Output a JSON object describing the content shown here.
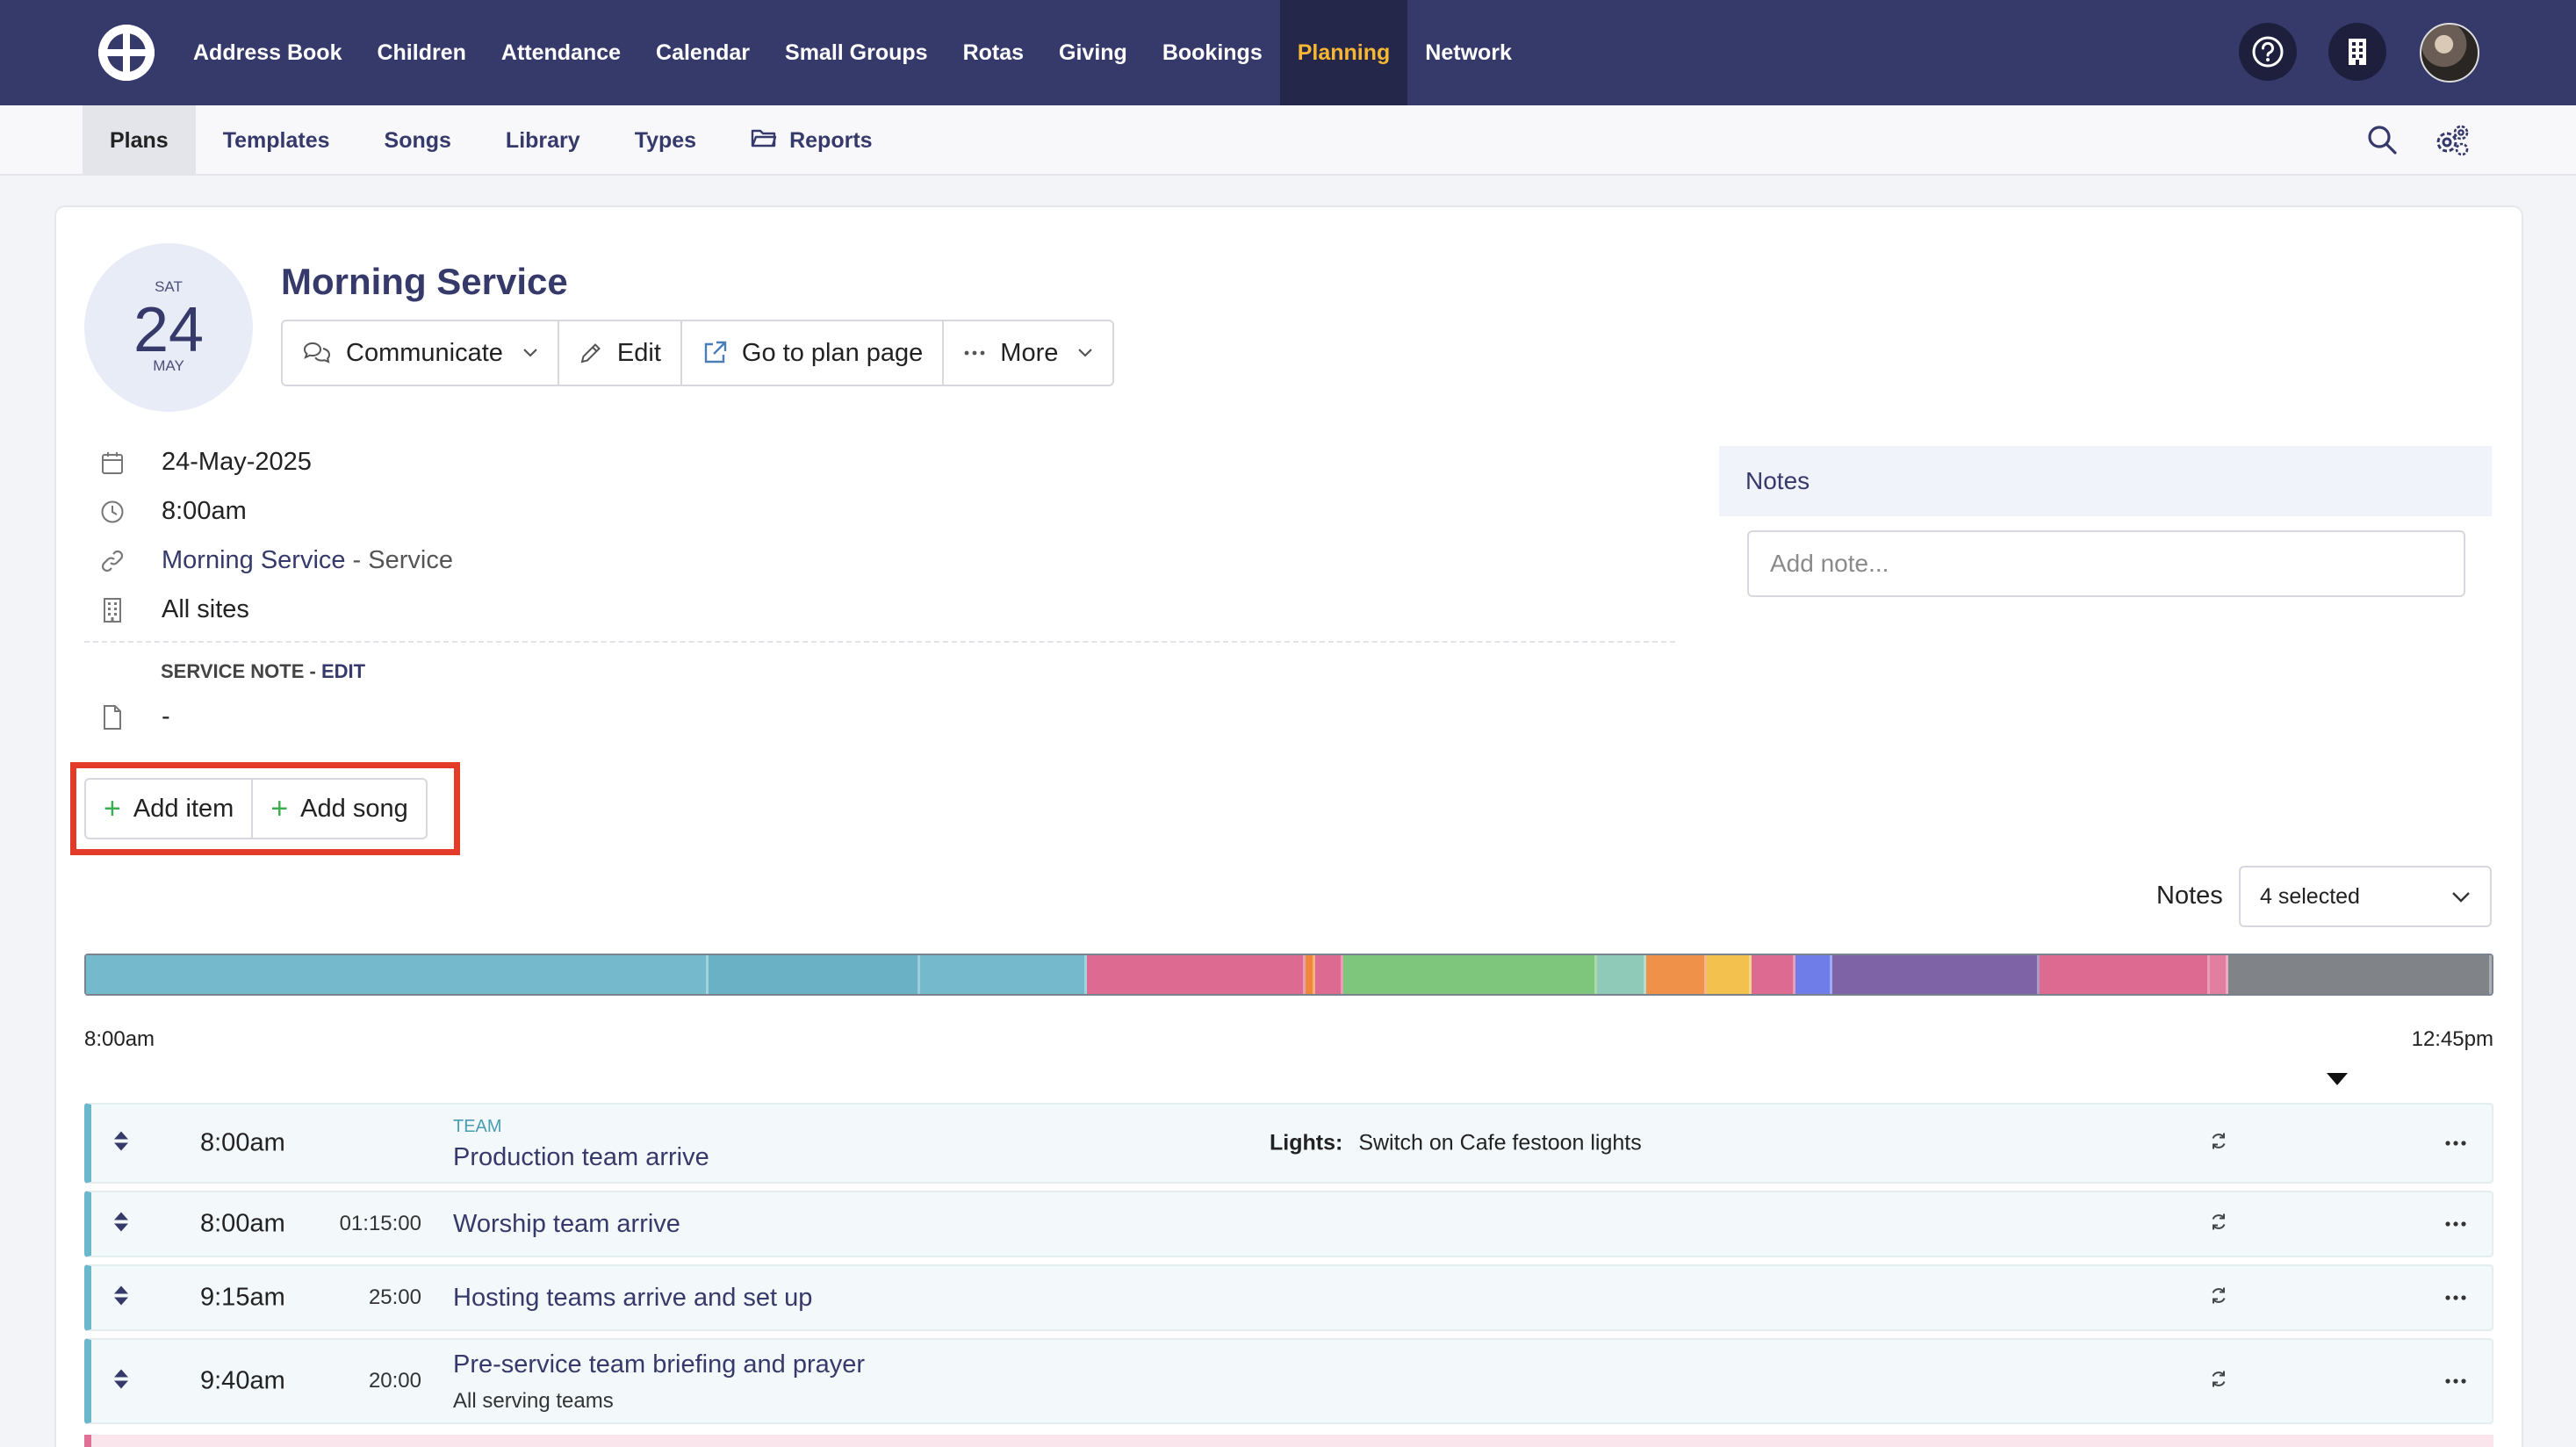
{
  "top_nav": {
    "items": [
      {
        "label": "Address Book"
      },
      {
        "label": "Children"
      },
      {
        "label": "Attendance"
      },
      {
        "label": "Calendar"
      },
      {
        "label": "Small Groups"
      },
      {
        "label": "Rotas"
      },
      {
        "label": "Giving"
      },
      {
        "label": "Bookings"
      },
      {
        "label": "Planning",
        "active": true
      },
      {
        "label": "Network"
      }
    ],
    "icons": [
      "logo-icon",
      "help-icon",
      "building-icon",
      "avatar"
    ]
  },
  "sub_nav": {
    "items": [
      {
        "label": "Plans",
        "active": true
      },
      {
        "label": "Templates"
      },
      {
        "label": "Songs"
      },
      {
        "label": "Library"
      },
      {
        "label": "Types"
      },
      {
        "label": "Reports",
        "icon": "folder-icon"
      }
    ],
    "right_icons": [
      "search-icon",
      "settings-icon"
    ]
  },
  "plan": {
    "date_badge": {
      "dow": "SAT",
      "day": "24",
      "month": "MAY"
    },
    "title": "Morning Service",
    "actions": {
      "communicate": "Communicate",
      "edit": "Edit",
      "go_to_plan": "Go to plan page",
      "more": "More"
    },
    "details": {
      "date": "24-May-2025",
      "time": "8:00am",
      "service_link": "Morning Service",
      "service_suffix": "- Service",
      "sites": "All sites"
    },
    "service_note": {
      "label": "SERVICE NOTE -",
      "edit": "EDIT",
      "value": "-"
    },
    "add_buttons": {
      "add_item": "Add item",
      "add_song": "Add song"
    }
  },
  "notes_panel": {
    "title": "Notes",
    "placeholder": "Add note..."
  },
  "notes_filter": {
    "label": "Notes",
    "selected": "4 selected"
  },
  "timeline": {
    "start": "8:00am",
    "end": "12:45pm",
    "segment_colors": [
      "#74b9cc",
      "#6ab1c6",
      "#74b9cc",
      "#dd6b91",
      "#f0883b",
      "#dd6b91",
      "#7dc67c",
      "#8fc9b8",
      "#f0914a",
      "#f2c14e",
      "#dd6b91",
      "#6f7de8",
      "#7e64a7",
      "#dd6b91",
      "#e27ea0",
      "#808488"
    ],
    "segment_weights": [
      385,
      130,
      102,
      134,
      4,
      16,
      156,
      29,
      36,
      26,
      26,
      21,
      127,
      104,
      10,
      162
    ]
  },
  "plan_items": [
    {
      "time": "8:00am",
      "duration": "",
      "category": "TEAM",
      "title": "Production team arrive",
      "note_label": "Lights:",
      "note_text": "Switch on Cafe festoon lights",
      "subtitle": ""
    },
    {
      "time": "8:00am",
      "duration": "01:15:00",
      "category": "",
      "title": "Worship team arrive",
      "note_label": "",
      "note_text": "",
      "subtitle": ""
    },
    {
      "time": "9:15am",
      "duration": "25:00",
      "category": "",
      "title": "Hosting teams arrive and set up",
      "note_label": "",
      "note_text": "",
      "subtitle": ""
    },
    {
      "time": "9:40am",
      "duration": "20:00",
      "category": "",
      "title": "Pre-service team briefing and prayer",
      "note_label": "",
      "note_text": "",
      "subtitle": "All serving teams"
    }
  ]
}
